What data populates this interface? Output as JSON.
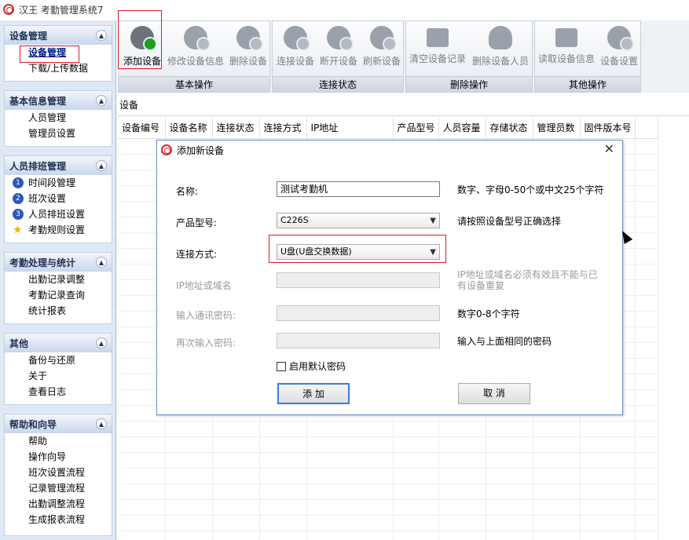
{
  "window": {
    "title": "汉王 考勤管理系统7"
  },
  "sidebar": {
    "groups": [
      {
        "title": "设备管理",
        "items": [
          {
            "label": "设备管理"
          },
          {
            "label": "下载/上传数据"
          }
        ]
      },
      {
        "title": "基本信息管理",
        "items": [
          {
            "label": "人员管理"
          },
          {
            "label": "管理员设置"
          }
        ]
      },
      {
        "title": "人员排班管理",
        "items": [
          {
            "num": "1",
            "label": "时间段管理"
          },
          {
            "num": "2",
            "label": "班次设置"
          },
          {
            "num": "3",
            "label": "人员排班设置"
          },
          {
            "label": "考勤规则设置"
          }
        ]
      },
      {
        "title": "考勤处理与统计",
        "items": [
          {
            "label": "出勤记录调整"
          },
          {
            "label": "考勤记录查询"
          },
          {
            "label": "统计报表"
          }
        ]
      },
      {
        "title": "其他",
        "items": [
          {
            "label": "备份与还原"
          },
          {
            "label": "关于"
          },
          {
            "label": "查看日志"
          }
        ]
      },
      {
        "title": "帮助和向导",
        "items": [
          {
            "label": "帮助"
          },
          {
            "label": "操作向导"
          },
          {
            "label": "班次设置流程"
          },
          {
            "label": "记录管理流程"
          },
          {
            "label": "出勤调整流程"
          },
          {
            "label": "生成报表流程"
          }
        ]
      }
    ]
  },
  "toolbar": {
    "groups": [
      {
        "title": "基本操作",
        "buttons": [
          {
            "label": "添加设备",
            "icon": "add-device-icon"
          },
          {
            "label": "修改设备信息",
            "icon": "edit-device-icon"
          },
          {
            "label": "删除设备",
            "icon": "delete-device-icon"
          }
        ]
      },
      {
        "title": "连接状态",
        "buttons": [
          {
            "label": "连接设备",
            "icon": "connect-icon"
          },
          {
            "label": "断开设备",
            "icon": "disconnect-icon"
          },
          {
            "label": "刷新设备",
            "icon": "refresh-icon"
          }
        ]
      },
      {
        "title": "删除操作",
        "buttons": [
          {
            "label": "清空设备记录",
            "icon": "clear-records-icon"
          },
          {
            "label": "删除设备人员",
            "icon": "delete-person-icon"
          }
        ]
      },
      {
        "title": "其他操作",
        "buttons": [
          {
            "label": "读取设备信息",
            "icon": "read-info-icon"
          },
          {
            "label": "设备设置",
            "icon": "device-settings-icon"
          }
        ]
      }
    ]
  },
  "content": {
    "section_label": "设备",
    "columns": [
      "设备编号",
      "设备名称",
      "连接状态",
      "连接方式",
      "IP地址",
      "产品型号",
      "人员容量",
      "存储状态",
      "管理员数",
      "固件版本号"
    ]
  },
  "dialog": {
    "title": "添加新设备",
    "close": "✕",
    "name_label": "名称:",
    "name_value": "测试考勤机",
    "name_hint": "数字、字母0-50个或中文25个字符",
    "model_label": "产品型号:",
    "model_value": "C226S",
    "model_hint": "请按照设备型号正确选择",
    "conn_label": "连接方式:",
    "conn_value": "U盘(U盘交换数据)",
    "ip_label": "IP地址或域名",
    "ip_hint": "IP地址或域名必须有效且不能与已有设备重复",
    "pwd_label": "输入通讯密码:",
    "pwd_hint": "数字0-8个字符",
    "pwd2_label": "再次输入密码:",
    "pwd2_hint": "输入与上面相同的密码",
    "default_pwd_label": "启用默认密码",
    "add_button": "添 加",
    "cancel_button": "取 消"
  }
}
